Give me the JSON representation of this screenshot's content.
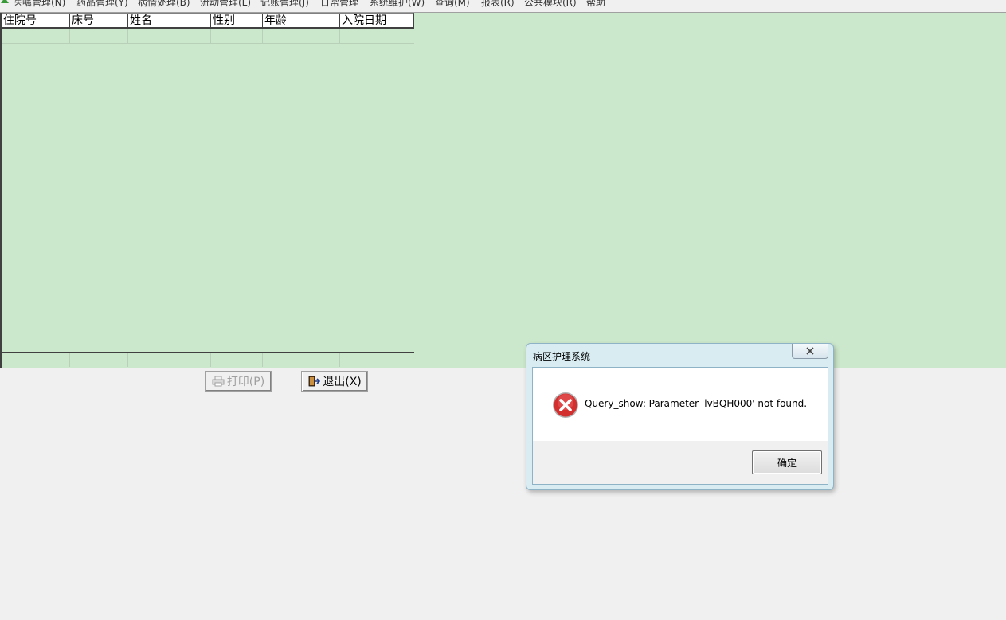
{
  "menu": {
    "items": [
      "医嘱管理(N)",
      "药品管理(Y)",
      "病情处理(B)",
      "流动管理(L)",
      "记账管理(J)",
      "日常管理",
      "系统维护(W)",
      "查询(M)",
      "报表(R)",
      "公共模块(R)",
      "帮助"
    ]
  },
  "grid": {
    "columns": [
      "住院号",
      "床号",
      "姓名",
      "性别",
      "年龄",
      "入院日期"
    ],
    "rows": [
      [
        "",
        "",
        "",
        "",
        "",
        ""
      ]
    ]
  },
  "buttons": {
    "print_label": "打印(P)",
    "exit_label": "退出(X)"
  },
  "dialog": {
    "title": "病区护理系统",
    "close_label": "X",
    "message": "Query_show: Parameter 'lvBQH000' not found.",
    "ok_label": "确定"
  },
  "colors": {
    "grid_background": "#cce8cc",
    "window_background": "#f0f0f0",
    "error_icon": "#d32f2f"
  }
}
